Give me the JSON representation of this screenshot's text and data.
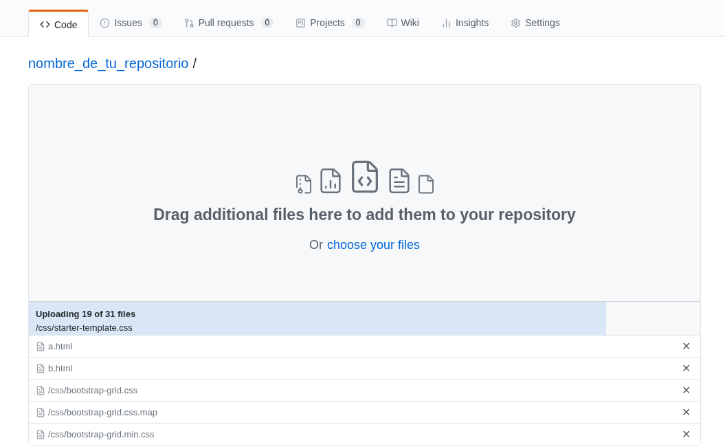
{
  "tabs": [
    {
      "kind": "code",
      "label": "Code",
      "selected": true
    },
    {
      "kind": "issues",
      "label": "Issues",
      "count": "0",
      "selected": false
    },
    {
      "kind": "pulls",
      "label": "Pull requests",
      "count": "0",
      "selected": false
    },
    {
      "kind": "projects",
      "label": "Projects",
      "count": "0",
      "selected": false
    },
    {
      "kind": "wiki",
      "label": "Wiki",
      "selected": false
    },
    {
      "kind": "insights",
      "label": "Insights",
      "selected": false
    },
    {
      "kind": "settings",
      "label": "Settings",
      "selected": false
    }
  ],
  "breadcrumb": {
    "repo": "nombre_de_tu_repositorio",
    "separator": "/"
  },
  "dropzone": {
    "heading": "Drag additional files here to add them to your repository",
    "prefix": "Or",
    "link": "choose your files"
  },
  "upload": {
    "status": "Uploading 19 of 31 files",
    "current": "/css/starter-template.css",
    "level": 0.86
  },
  "files": [
    {
      "name": "a.html",
      "remove": "✕"
    },
    {
      "name": "b.html",
      "remove": "✕"
    },
    {
      "name": "/css/bootstrap-grid.css",
      "remove": "✕"
    },
    {
      "name": "/css/bootstrap-grid.css.map",
      "remove": "✕"
    },
    {
      "name": "/css/bootstrap-grid.min.css",
      "remove": "✕"
    }
  ]
}
